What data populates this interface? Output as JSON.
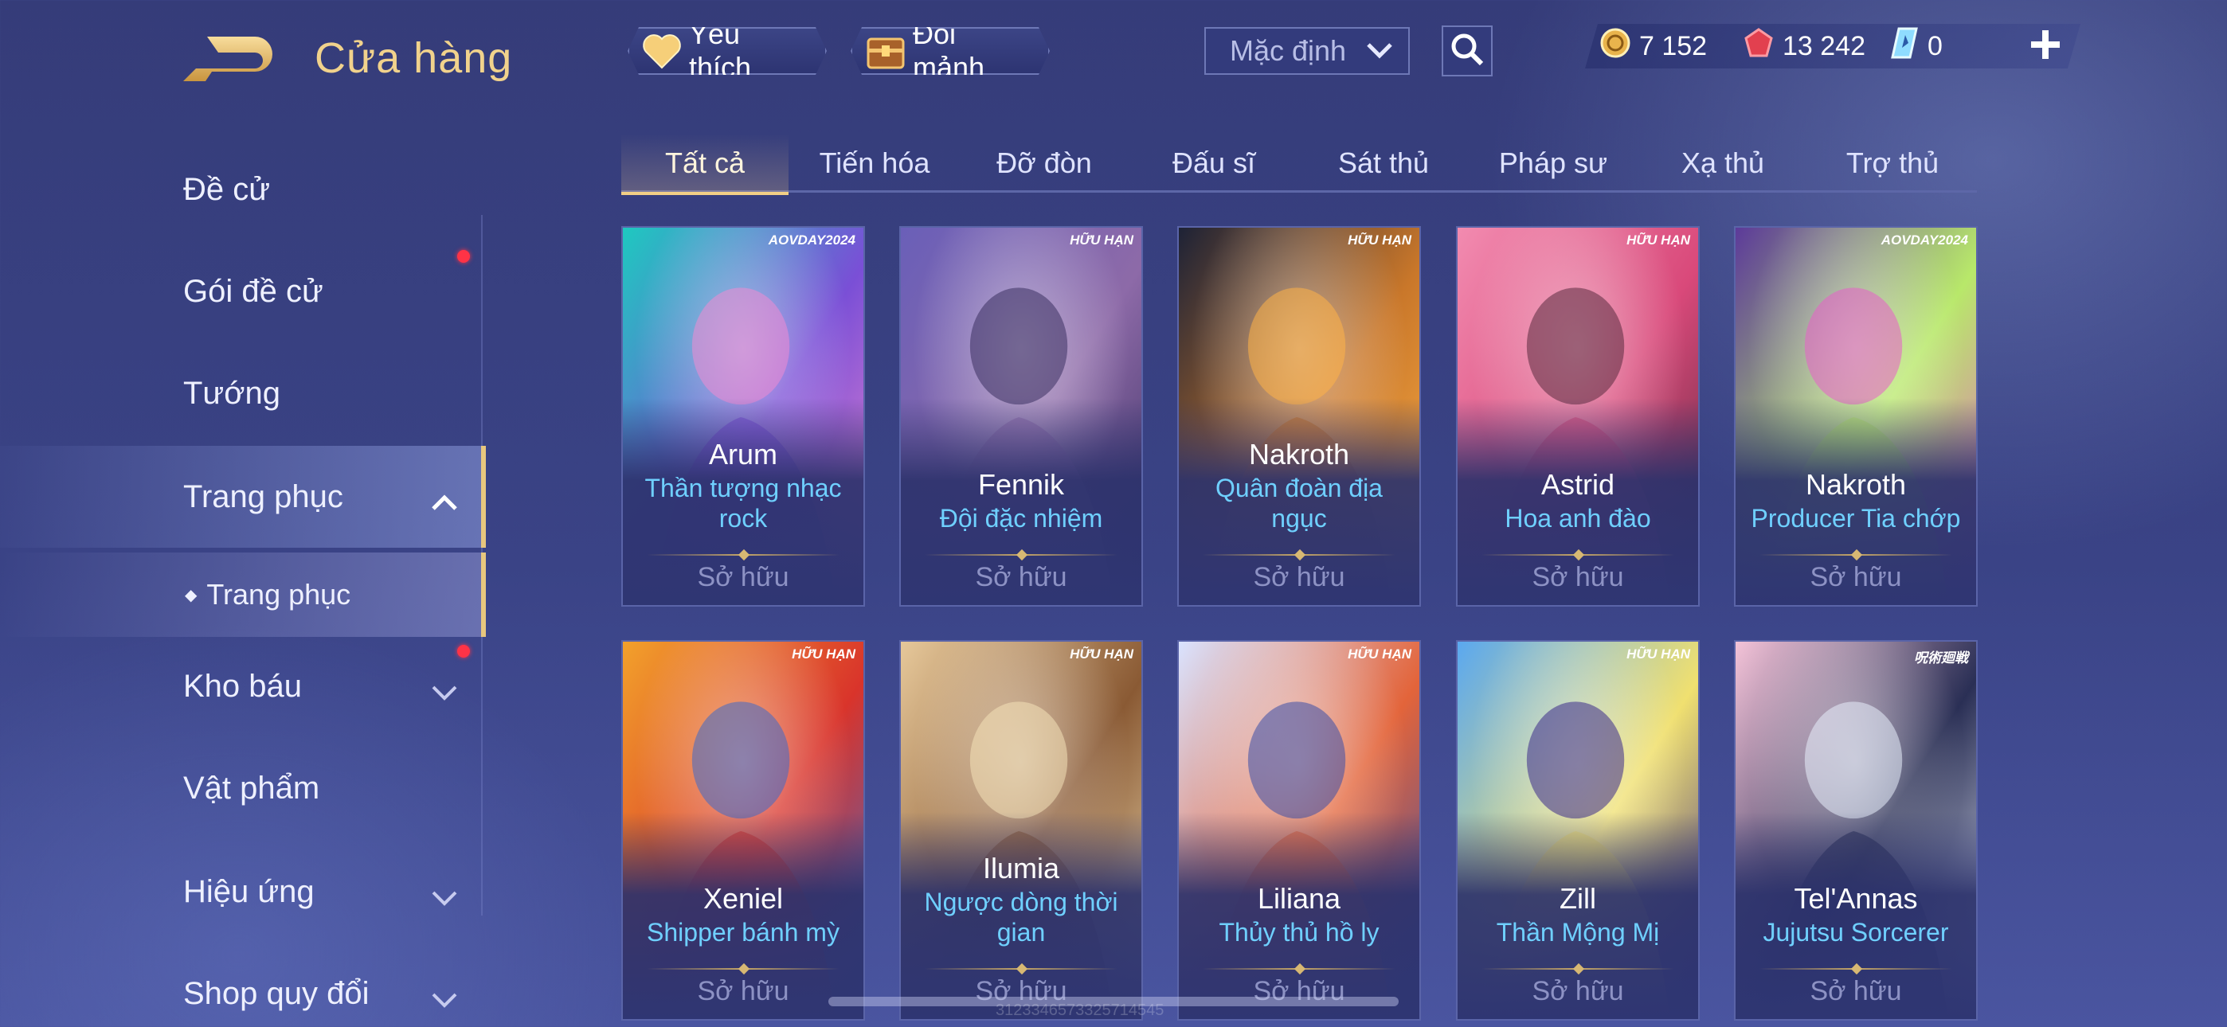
{
  "header": {
    "title": "Cửa hàng",
    "back_icon": "back-arrow-icon",
    "favorite_label": "Yêu thích",
    "shard_label": "Đổi mảnh",
    "sort_selected": "Mặc định",
    "currencies": [
      {
        "name": "gold-coin",
        "value": "7 152"
      },
      {
        "name": "ruby",
        "value": "13 242"
      },
      {
        "name": "voucher",
        "value": "0"
      }
    ]
  },
  "sidebar": {
    "items": [
      {
        "label": "Đề cử"
      },
      {
        "label": "Gói đề cử",
        "notification": true
      },
      {
        "label": "Tướng"
      },
      {
        "label": "Trang phục",
        "expanded": true,
        "active": true
      },
      {
        "label": "Trang phục",
        "sub": true,
        "active": true
      },
      {
        "label": "Kho báu",
        "notification": true
      },
      {
        "label": "Vật phẩm"
      },
      {
        "label": "Hiệu ứng"
      },
      {
        "label": "Shop quy đổi"
      }
    ]
  },
  "tabs": [
    {
      "label": "Tất cả",
      "active": true
    },
    {
      "label": "Tiến hóa"
    },
    {
      "label": "Đỡ đòn"
    },
    {
      "label": "Đấu sĩ"
    },
    {
      "label": "Sát thủ"
    },
    {
      "label": "Pháp sư"
    },
    {
      "label": "Xạ thủ"
    },
    {
      "label": "Trợ thủ"
    }
  ],
  "cards": [
    {
      "hero": "Arum",
      "skin": "Thần tượng nhạc",
      "skin2": "rock",
      "status": "Sở hữu",
      "badge_text": "AOVDAY2024",
      "palette": [
        "#1ec9c0",
        "#7a4fd6",
        "#f08ad1"
      ]
    },
    {
      "hero": "Fennik",
      "skin": "Đội đặc nhiệm",
      "skin2": "",
      "status": "Sở hữu",
      "badge_text": "HỮU HẠN",
      "palette": [
        "#6a5fb8",
        "#8d6aa8",
        "#3a2f60"
      ]
    },
    {
      "hero": "Nakroth",
      "skin": "Quân đoàn địa",
      "skin2": "ngục",
      "status": "Sở hữu",
      "badge_text": "HỮU HẠN",
      "palette": [
        "#1d2236",
        "#c9772a",
        "#ffb347"
      ]
    },
    {
      "hero": "Astrid",
      "skin": "Hoa anh đào",
      "skin2": "",
      "status": "Sở hữu",
      "badge_text": "HỮU HẠN",
      "palette": [
        "#f28bb0",
        "#d9497a",
        "#5a2a3e"
      ]
    },
    {
      "hero": "Nakroth",
      "skin": "Producer Tia chớp",
      "skin2": "",
      "status": "Sở hữu",
      "badge_text": "AOVDAY2024",
      "palette": [
        "#5c3a9a",
        "#b8e86a",
        "#e85fc9"
      ]
    },
    {
      "hero": "Xeniel",
      "skin": "Shipper bánh mỳ",
      "skin2": "",
      "status": "Sở hữu",
      "badge_text": "HỮU HẠN",
      "palette": [
        "#f2a12b",
        "#d9342b",
        "#3e6ac9"
      ]
    },
    {
      "hero": "Ilumia",
      "skin": "Ngược dòng thời",
      "skin2": "gian",
      "status": "Sở hữu",
      "badge_text": "HỮU HẠN",
      "palette": [
        "#e6c89a",
        "#8a5a34",
        "#f4e2b8"
      ]
    },
    {
      "hero": "Liliana",
      "skin": "Thủy thủ hồ ly",
      "skin2": "",
      "status": "Sở hữu",
      "badge_text": "HỮU HẠN",
      "palette": [
        "#d9e3ff",
        "#e3643a",
        "#3a4fa8"
      ]
    },
    {
      "hero": "Zill",
      "skin": "Thần Mộng Mị",
      "skin2": "",
      "status": "Sở hữu",
      "badge_text": "HỮU HẠN",
      "palette": [
        "#5aa8f0",
        "#f0e070",
        "#3a2a8a"
      ]
    },
    {
      "hero": "Tel'Annas",
      "skin": "Jujutsu Sorcerer",
      "skin2": "",
      "status": "Sở hữu",
      "badge_text": "呪術廻戦",
      "palette": [
        "#f4c3d8",
        "#2a2f55",
        "#e8eefc"
      ]
    }
  ],
  "footer_uid": "3123346573325714545"
}
